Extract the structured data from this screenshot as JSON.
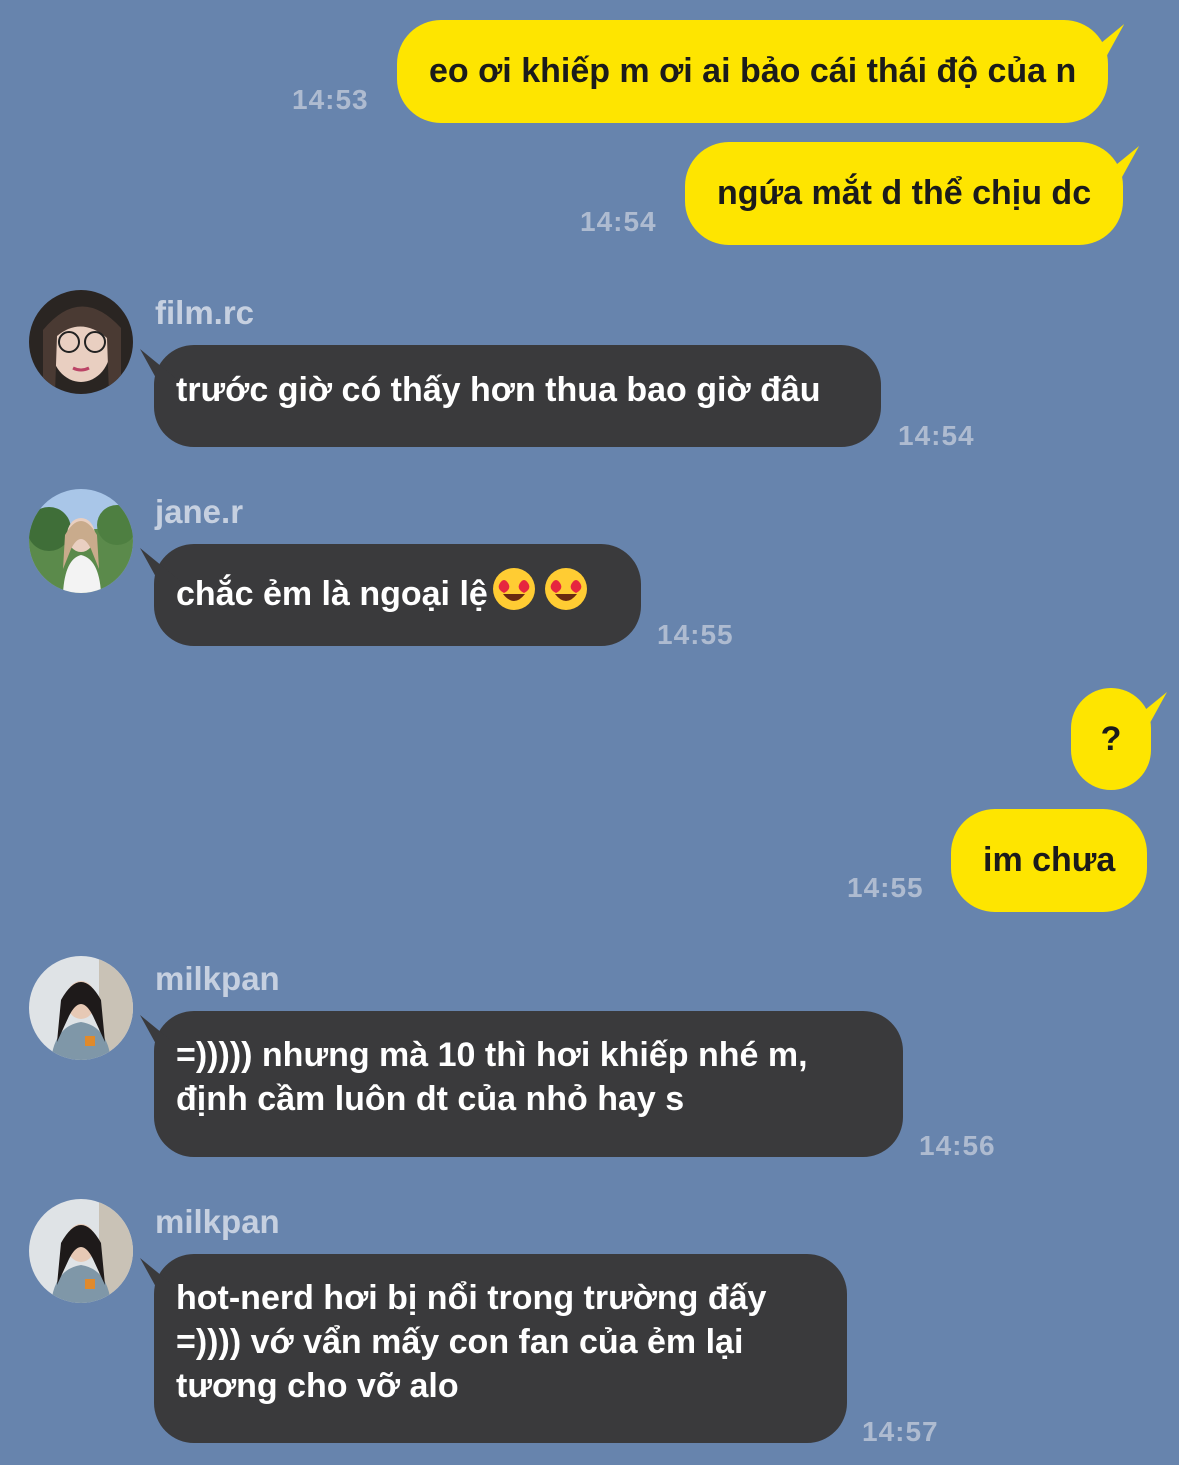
{
  "colors": {
    "background": "#6784ad",
    "outgoing_bubble": "#fee500",
    "incoming_bubble": "#3a3a3c",
    "timestamp": "#aebbd0",
    "sender_name": "#c6d0e0"
  },
  "messages": [
    {
      "direction": "outgoing",
      "text": "eo ơi khiếp m ơi ai bảo cái thái độ của n",
      "time": "14:53"
    },
    {
      "direction": "outgoing",
      "text": "ngứa mắt d thể chịu dc",
      "time": "14:54"
    },
    {
      "direction": "incoming",
      "sender": "film.rc",
      "avatar": "avatar-film-rc",
      "text": "trước giờ có thấy hơn thua bao giờ đâu",
      "time": "14:54"
    },
    {
      "direction": "incoming",
      "sender": "jane.r",
      "avatar": "avatar-jane-r",
      "text": "chắc ẻm là ngoại lệ",
      "emojis": [
        "heart-eyes-emoji",
        "heart-eyes-emoji"
      ],
      "time": "14:55"
    },
    {
      "direction": "outgoing",
      "text": "?",
      "time": ""
    },
    {
      "direction": "outgoing",
      "text": "im chưa",
      "time": "14:55"
    },
    {
      "direction": "incoming",
      "sender": "milkpan",
      "avatar": "avatar-milkpan",
      "lines": [
        "=))))) nhưng mà 10 thì hơi khiếp nhé m,",
        "định cầm luôn dt của nhỏ hay s"
      ],
      "time": "14:56"
    },
    {
      "direction": "incoming",
      "sender": "milkpan",
      "avatar": "avatar-milkpan",
      "lines": [
        "hot-nerd hơi bị nổi trong trường đấy",
        "=)))) vớ vẩn mấy con fan của ẻm lại",
        "tương cho vỡ alo"
      ],
      "time": "14:57"
    }
  ]
}
